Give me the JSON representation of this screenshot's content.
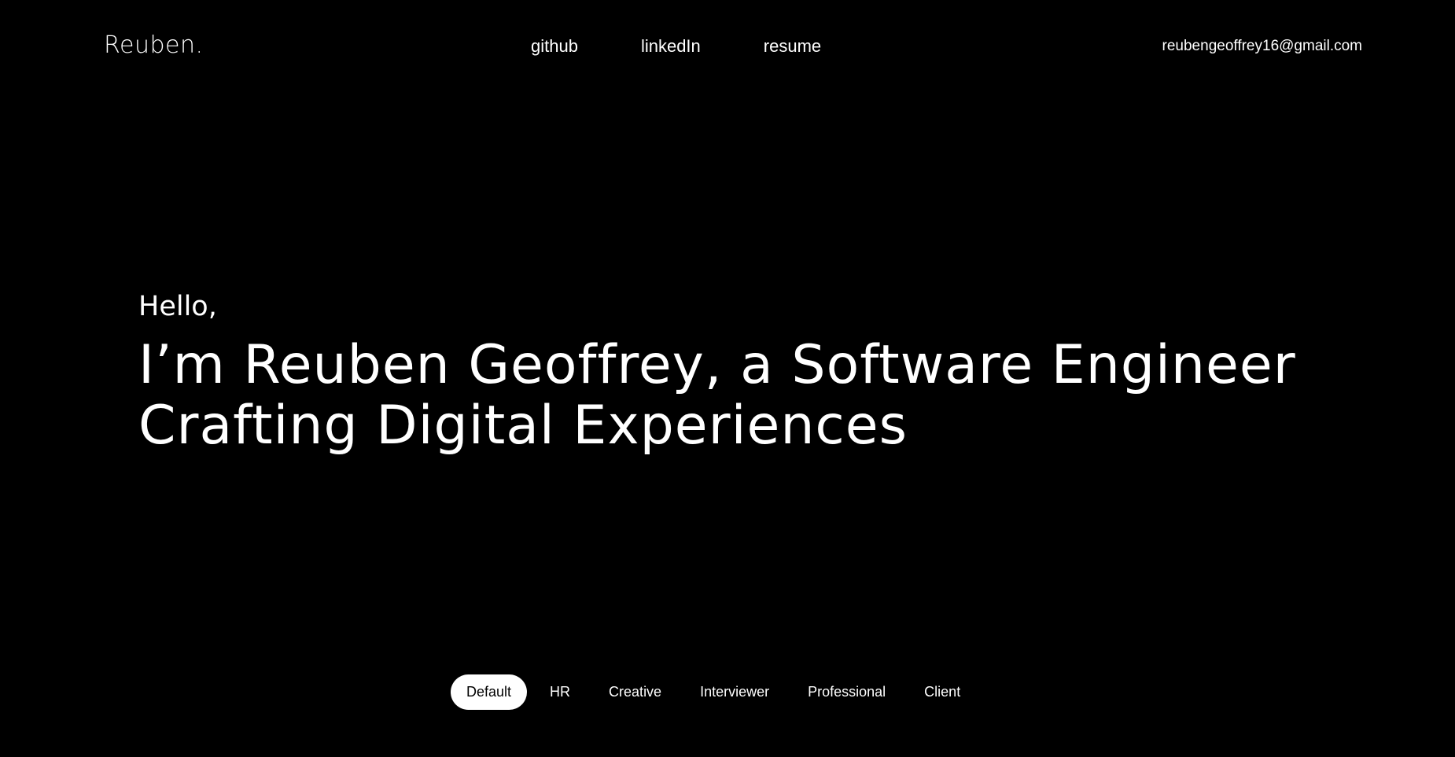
{
  "header": {
    "logo": "Reuben.",
    "nav": {
      "github": "github",
      "linkedin": "linkedIn",
      "resume": "resume"
    },
    "email": "reubengeoffrey16@gmail.com"
  },
  "hero": {
    "greeting": "Hello,",
    "headline_line1": "I’m Reuben Geoffrey, a Software Engineer",
    "headline_line2": "Crafting Digital Experiences"
  },
  "persona_switch": {
    "selected": "Default",
    "options": [
      "Default",
      "HR",
      "Creative",
      "Interviewer",
      "Professional",
      "Client"
    ]
  },
  "colors": {
    "background": "#000000",
    "text": "#ffffff",
    "active_pill_bg": "#ffffff",
    "active_pill_text": "#000000"
  }
}
